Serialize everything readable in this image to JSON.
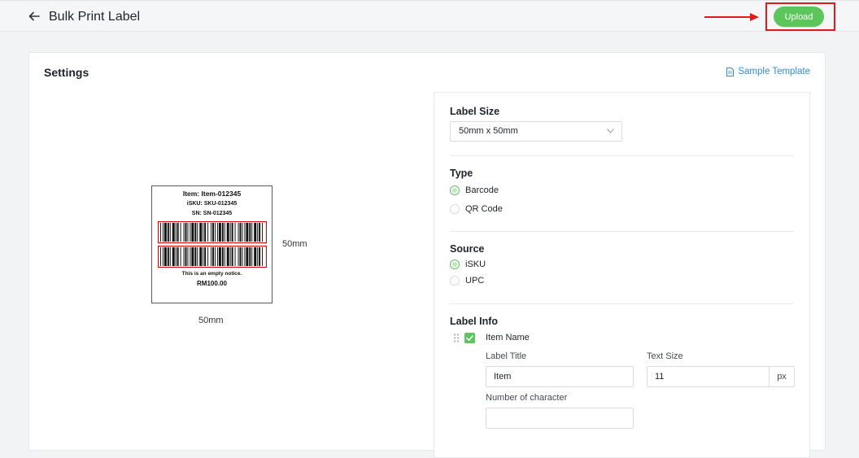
{
  "header": {
    "title": "Bulk Print Label",
    "upload_label": "Upload",
    "back_icon": "arrow-left-icon"
  },
  "annotation": {
    "highlight_color": "#e0191b"
  },
  "settings": {
    "title": "Settings",
    "sample_template_label": "Sample Template"
  },
  "preview": {
    "item": "Item: Item-012345",
    "isku": "iSKU: SKU-012345",
    "sn": "SN: SN-012345",
    "notice": "This is an empty notice.",
    "price": "RM100.00",
    "width_label": "50mm",
    "height_label": "50mm"
  },
  "form": {
    "label_size": {
      "title": "Label Size",
      "value": "50mm x 50mm"
    },
    "type": {
      "title": "Type",
      "options": [
        {
          "label": "Barcode",
          "selected": true
        },
        {
          "label": "QR Code",
          "selected": false
        }
      ]
    },
    "source": {
      "title": "Source",
      "options": [
        {
          "label": "iSKU",
          "selected": true
        },
        {
          "label": "UPC",
          "selected": false
        }
      ]
    },
    "label_info": {
      "title": "Label Info",
      "item_name": {
        "label": "Item Name",
        "checked": true
      },
      "label_title": {
        "label": "Label Title",
        "value": "Item"
      },
      "text_size": {
        "label": "Text Size",
        "value": "11",
        "unit": "px"
      },
      "num_chars": {
        "label": "Number of character",
        "value": ""
      }
    }
  },
  "colors": {
    "accent": "#5cc55c",
    "link": "#2f8fd8"
  }
}
